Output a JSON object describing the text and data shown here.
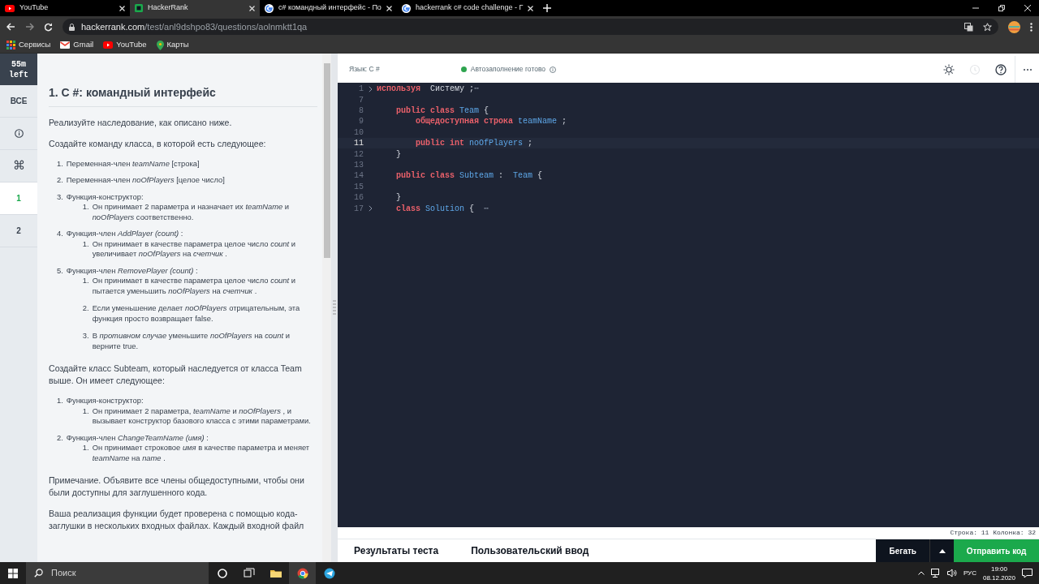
{
  "browser": {
    "tabs": [
      {
        "kind": "youtube",
        "title": "YouTube",
        "selected": false
      },
      {
        "kind": "hackerrank",
        "title": "HackerRank",
        "selected": true
      },
      {
        "kind": "google",
        "title": "c# командный интерфейс - По",
        "selected": false
      },
      {
        "kind": "google",
        "title": "hackerrank c# code challenge - Г",
        "selected": false
      }
    ],
    "url": {
      "host": "hackerrank.com",
      "path": "/test/anl9dshpo83/questions/aolnmktt1qa"
    },
    "bookmarks": [
      {
        "kind": "apps",
        "label": "Сервисы"
      },
      {
        "kind": "mail",
        "label": "Gmail"
      },
      {
        "kind": "youtube",
        "label": "YouTube"
      },
      {
        "kind": "map",
        "label": "Карты"
      }
    ]
  },
  "test_nav": {
    "timer": "55m left",
    "items": [
      {
        "kind": "text",
        "label": "ВСЕ",
        "selected": false
      },
      {
        "kind": "info",
        "selected": false
      },
      {
        "kind": "text",
        "label": "⌘",
        "selected": false
      },
      {
        "kind": "text",
        "label": "1",
        "selected": true
      },
      {
        "kind": "text",
        "label": "2",
        "selected": false
      }
    ]
  },
  "problem": {
    "title": "1. С #: командный интерфейс",
    "blocks": [
      {
        "kind": "paragraph",
        "text": "Реализуйте наследование, как описано ниже."
      },
      {
        "kind": "paragraph",
        "text": "Создайте команду класса, в которой есть следующее:"
      },
      {
        "kind": "list",
        "items": [
          {
            "number": "1.",
            "text": "Переменная-член *teamName* [строка]"
          },
          {
            "number": "2.",
            "text": "Переменная-член *noOfPlayers* [целое число]"
          },
          {
            "number": "3.",
            "text": "Функция-конструктор:",
            "children": [
              {
                "number": "1.",
                "text": "Он принимает 2 параметра и назначает их *teamName* и *noOfPlayers* соответственно."
              }
            ]
          },
          {
            "number": "4.",
            "text": "Функция-член *AddPlayer (count)* :",
            "children": [
              {
                "number": "1.",
                "text": "Он принимает в качестве параметра целое число *count* и увеличивает *noOfPlayers* на *счетчик* ."
              }
            ]
          },
          {
            "number": "5.",
            "text": "Функция-член *RemovePlayer (count)* :",
            "children": [
              {
                "number": "1.",
                "text": "Он принимает в качестве параметра целое число *count* и пытается уменьшить *noOfPlayers* на *счетчик* ."
              },
              {
                "number": "2.",
                "text": "Если уменьшение делает *noOfPlayers* отрицательным, эта функция просто возвращает false."
              },
              {
                "number": "3.",
                "text": "В *противном случае* уменьшите *noOfPlayers* на *count* и верните true."
              }
            ]
          }
        ]
      },
      {
        "kind": "paragraph",
        "text": "Создайте класс Subteam, который наследуется от класса Team выше. Он имеет следующее:"
      },
      {
        "kind": "list",
        "items": [
          {
            "number": "1.",
            "text": "Функция-конструктор:",
            "children": [
              {
                "number": "1.",
                "text": "Он принимает 2 параметра, *teamName* и *noOfPlayers* , и вызывает конструктор базового класса с этими параметрами."
              }
            ]
          },
          {
            "number": "2.",
            "text": "Функция-член *ChangeTeamName (имя)* :",
            "children": [
              {
                "number": "1.",
                "text": "Он принимает строковое *имя* в качестве параметра и меняет *teamName* на *name* ."
              }
            ]
          }
        ]
      },
      {
        "kind": "paragraph",
        "text": "Примечание. Объявите все члены общедоступными, чтобы они были доступны для заглушенного кода."
      },
      {
        "kind": "paragraph",
        "text": "Ваша реализация функции будет проверена с помощью кода-заглушки в нескольких входных файлах. Каждый входной файл"
      }
    ]
  },
  "editor": {
    "language": "Язык: С #",
    "autocomplete": {
      "text": "Автозаполнение готово",
      "color": "#2ea44f"
    },
    "tools": [
      {
        "kind": "theme",
        "disabled": false
      },
      {
        "kind": "history",
        "disabled": true
      },
      {
        "kind": "help",
        "disabled": false
      },
      {
        "kind": "more",
        "disabled": false
      }
    ],
    "lines": [
      {
        "number": "1",
        "fold": true,
        "current": false,
        "tokens": [
          {
            "kind": "keyword",
            "text": "используя"
          },
          {
            "kind": "plain",
            "text": "  Систему ;"
          },
          {
            "kind": "fold",
            "text": "⋯"
          }
        ]
      },
      {
        "number": "7",
        "fold": false,
        "current": false
      },
      {
        "number": "8",
        "fold": false,
        "current": false,
        "tokens": [
          {
            "kind": "keyword",
            "text": "    public class"
          },
          {
            "kind": "type",
            "text": " Team"
          },
          {
            "kind": "plain",
            "text": " {"
          }
        ]
      },
      {
        "number": "9",
        "fold": false,
        "current": false,
        "tokens": [
          {
            "kind": "keyword",
            "text": "        общедоступная строка"
          },
          {
            "kind": "type",
            "text": " teamName"
          },
          {
            "kind": "plain",
            "text": " ;"
          }
        ]
      },
      {
        "number": "10",
        "fold": false,
        "current": false
      },
      {
        "number": "11",
        "fold": false,
        "current": true,
        "tokens": [
          {
            "kind": "keyword",
            "text": "        public int"
          },
          {
            "kind": "type",
            "text": " noOfPlayers"
          },
          {
            "kind": "plain",
            "text": " ;"
          }
        ]
      },
      {
        "number": "12",
        "fold": false,
        "current": false,
        "tokens": [
          {
            "kind": "plain",
            "text": "    }"
          }
        ]
      },
      {
        "number": "13",
        "fold": false,
        "current": false
      },
      {
        "number": "14",
        "fold": false,
        "current": false,
        "tokens": [
          {
            "kind": "keyword",
            "text": "    public class"
          },
          {
            "kind": "type",
            "text": " Subteam"
          },
          {
            "kind": "plain",
            "text": " :  "
          },
          {
            "kind": "type",
            "text": "Team"
          },
          {
            "kind": "plain",
            "text": " {"
          }
        ]
      },
      {
        "number": "15",
        "fold": false,
        "current": false
      },
      {
        "number": "16",
        "fold": false,
        "current": false,
        "tokens": [
          {
            "kind": "plain",
            "text": "    }"
          }
        ]
      },
      {
        "number": "17",
        "fold": true,
        "current": false,
        "tokens": [
          {
            "kind": "keyword",
            "text": "    class"
          },
          {
            "kind": "type",
            "text": " Solution"
          },
          {
            "kind": "plain",
            "text": " {  "
          },
          {
            "kind": "fold",
            "text": "⋯"
          }
        ]
      }
    ],
    "cursor_position": "Строка: 11 Колонка: 32",
    "bottom_tabs": [
      {
        "label": "Результаты теста",
        "selected": false
      },
      {
        "label": "Пользовательский ввод",
        "selected": false
      }
    ],
    "run_button": "Бегать",
    "submit_button": "Отправить код"
  },
  "taskbar": {
    "search_placeholder": "Поиск",
    "apps": [
      {
        "kind": "cortana"
      },
      {
        "kind": "taskview"
      },
      {
        "kind": "folder"
      },
      {
        "kind": "browser"
      },
      {
        "kind": "telegram"
      }
    ],
    "language": "РУС",
    "time": "19:00",
    "date": "08.12.2020"
  }
}
